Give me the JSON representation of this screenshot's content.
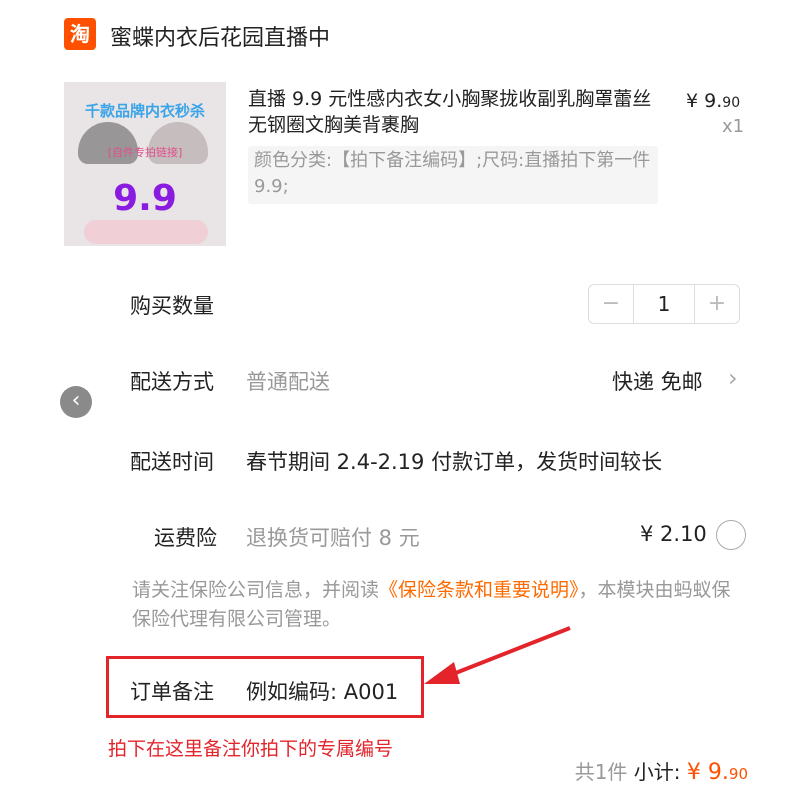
{
  "header": {
    "store_icon_glyph": "淘",
    "store_name": "蜜蝶内衣后花园直播中"
  },
  "product": {
    "thumb_text_1": "千款品牌内衣秒杀",
    "thumb_text_2": "[自件专拍链接]",
    "thumb_price": "9.9",
    "title": "直播 9.9 元性感内衣女小胸聚拢收副乳胸罩蕾丝无钢圈文胸美背裹胸",
    "price_symbol": "¥",
    "price_int": "9.",
    "price_dec": "90",
    "quantity_x": "x1",
    "sku": "颜色分类:【拍下备注编码】;尺码:直播拍下第一件 9.9;"
  },
  "quantity": {
    "label": "购买数量",
    "minus": "−",
    "value": "1",
    "plus": "+"
  },
  "shipping": {
    "label": "配送方式",
    "value": "普通配送",
    "method": "快递 免邮",
    "chevron": "›"
  },
  "nav": {
    "prev_glyph": "‹"
  },
  "delivery_time": {
    "label": "配送时间",
    "value": "春节期间 2.4-2.19 付款订单，发货时间较长"
  },
  "insurance": {
    "label": "运费险",
    "value": "退换货可赔付 8 元",
    "price": "¥ 2.10",
    "notice_pre": "请关注保险公司信息，并阅读",
    "notice_link": "《保险条款和重要说明》",
    "notice_post": "，本模块由蚂蚁保保险代理有限公司管理。"
  },
  "remark": {
    "label": "订单备注",
    "value": "例如编码: A001"
  },
  "annotation": {
    "text": "拍下在这里备注你拍下的专属编号",
    "color": "#e3242b"
  },
  "footer": {
    "count": "共1件",
    "subtotal_label": "小计:",
    "symbol": "¥",
    "int": "9.",
    "dec": "90"
  },
  "colors": {
    "brand": "#ff5000",
    "link": "#ff6a00",
    "muted": "#999999"
  }
}
